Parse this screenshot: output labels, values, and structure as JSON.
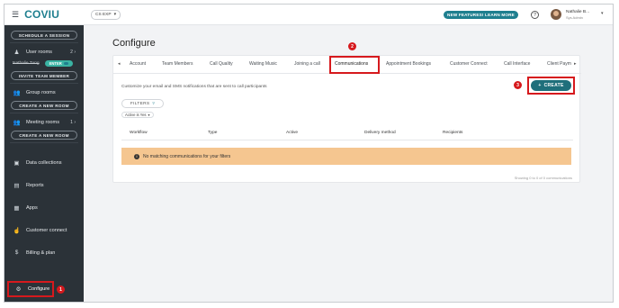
{
  "brand": {
    "logo": "COVIU",
    "menu_icon": "hamburger-icon"
  },
  "topbar": {
    "workspace": "CS EXP",
    "features_button": "NEW FEATURES! LEARN MORE",
    "help_icon": "?",
    "user_name": "Nathalie B...",
    "user_sub": "Sys Admin"
  },
  "sidebar": {
    "schedule_button": "SCHEDULE A SESSION",
    "user_rooms": {
      "label": "User rooms",
      "count": "2"
    },
    "waiting_room": {
      "label": "Nathalie Tung",
      "enter": "ENTER"
    },
    "invite_button": "INVITE TEAM MEMBER",
    "group_rooms": "Group rooms",
    "create_room_button": "CREATE A NEW ROOM",
    "meeting_rooms": {
      "label": "Meeting rooms",
      "count": "1"
    },
    "create_room_button_2": "CREATE A NEW ROOM",
    "data_collections": "Data collections",
    "reports": "Reports",
    "apps": "Apps",
    "customer_connect": "Customer connect",
    "billing": "Billing & plan",
    "configure": "Configure"
  },
  "badges": {
    "one": "1",
    "two": "2",
    "three": "3"
  },
  "main": {
    "title": "Configure",
    "tabs": [
      "Account",
      "Team Members",
      "Call Quality",
      "Waiting Music",
      "Joining a call",
      "Communications",
      "Appointment Bookings",
      "Customer Connect",
      "Call Interface",
      "Client Paym"
    ],
    "active_tab": "Communications",
    "description": "Customize your email and SMS notifications that are sent to call participants",
    "create_button": "CREATE",
    "filters_button": "FILTERS",
    "filter_chip": "Active is Yes",
    "columns": [
      "Workflow",
      "Type",
      "Active",
      "Delivery method",
      "Recipients"
    ],
    "empty_message": "No matching communications for your filters",
    "showing": "Showing 0 to 0 of 0 communications"
  },
  "colors": {
    "accent": "#1f7f8f",
    "sidebar": "#2b3238",
    "highlight": "#d6191d",
    "warning_row": "#f5c690"
  }
}
